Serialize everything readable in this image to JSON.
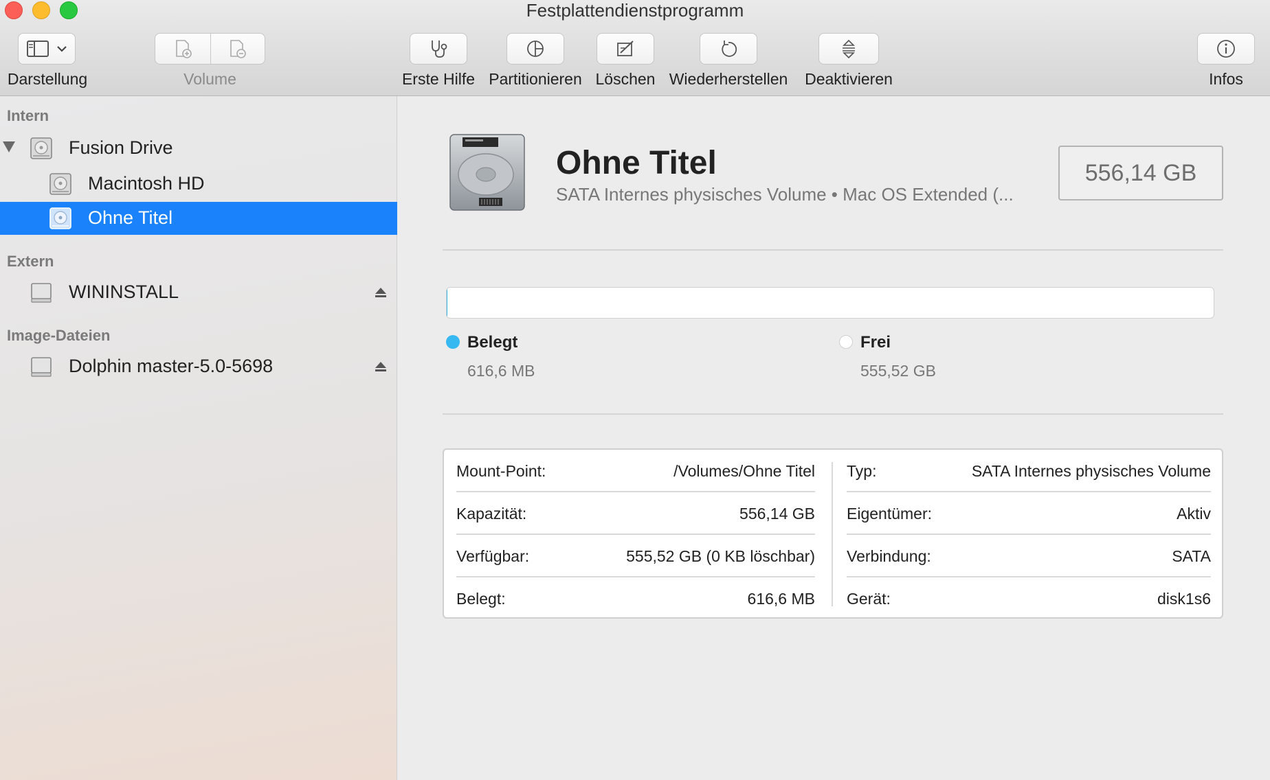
{
  "window": {
    "title": "Festplattendienstprogramm"
  },
  "toolbar": {
    "view_label": "Darstellung",
    "volume_label": "Volume",
    "first_aid_label": "Erste Hilfe",
    "partition_label": "Partitionieren",
    "erase_label": "Löschen",
    "restore_label": "Wiederherstellen",
    "unmount_label": "Deaktivieren",
    "info_label": "Infos"
  },
  "sidebar": {
    "sections": [
      {
        "header": "Intern"
      },
      {
        "header": "Extern"
      },
      {
        "header": "Image-Dateien"
      }
    ],
    "items": [
      {
        "label": "Fusion Drive"
      },
      {
        "label": "Macintosh HD"
      },
      {
        "label": "Ohne Titel",
        "selected": true
      },
      {
        "label": "WININSTALL"
      },
      {
        "label": "Dolphin master-5.0-5698"
      }
    ]
  },
  "volume": {
    "name": "Ohne Titel",
    "subtitle": "SATA Internes physisches Volume • Mac OS Extended (...",
    "size": "556,14 GB"
  },
  "usage": {
    "used_fraction": 0.0011,
    "used_color": "#38b8f0",
    "free_color": "#ffffff",
    "used": {
      "name": "Belegt",
      "value": "616,6 MB"
    },
    "free": {
      "name": "Frei",
      "value": "555,52 GB"
    }
  },
  "info": {
    "left": [
      {
        "key": "Mount-Point:",
        "value": "/Volumes/Ohne Titel"
      },
      {
        "key": "Kapazität:",
        "value": "556,14 GB"
      },
      {
        "key": "Verfügbar:",
        "value": "555,52 GB (0 KB löschbar)"
      },
      {
        "key": "Belegt:",
        "value": "616,6 MB"
      }
    ],
    "right": [
      {
        "key": "Typ:",
        "value": "SATA Internes physisches Volume"
      },
      {
        "key": "Eigentümer:",
        "value": "Aktiv"
      },
      {
        "key": "Verbindung:",
        "value": "SATA"
      },
      {
        "key": "Gerät:",
        "value": "disk1s6"
      }
    ]
  },
  "colors": {
    "selection": "#1a82fb",
    "accent_used": "#38b8f0"
  }
}
